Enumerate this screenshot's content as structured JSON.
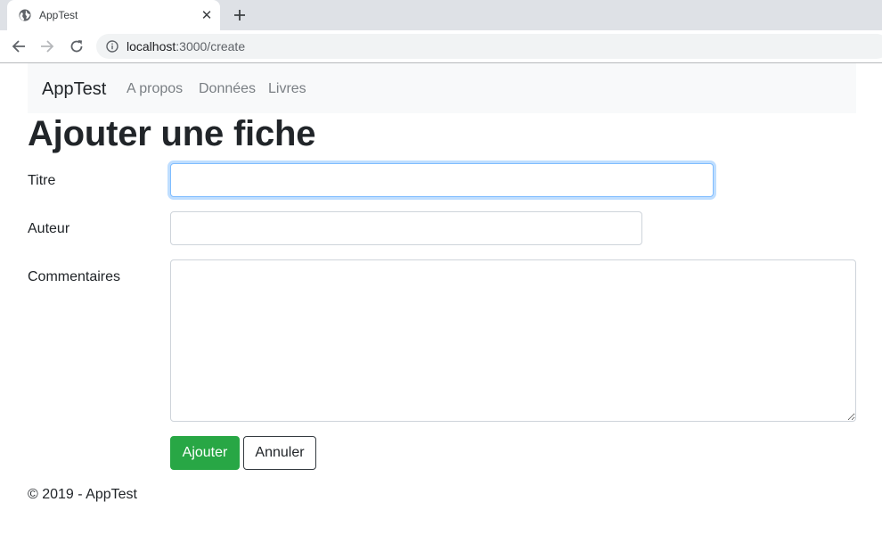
{
  "browser": {
    "tab_title": "AppTest",
    "close_glyph": "✕",
    "url_host": "localhost",
    "url_path": ":3000/create"
  },
  "navbar": {
    "brand": "AppTest",
    "links": [
      "A propos",
      "Données",
      "Livres"
    ]
  },
  "page": {
    "title": "Ajouter une fiche"
  },
  "form": {
    "fields": [
      {
        "label": "Titre",
        "value": "",
        "focused": true
      },
      {
        "label": "Auteur",
        "value": ""
      },
      {
        "label": "Commentaires",
        "value": ""
      }
    ],
    "buttons": {
      "submit": "Ajouter",
      "cancel": "Annuler"
    }
  },
  "footer": {
    "text": "© 2019 - AppTest"
  },
  "colors": {
    "success": "#28a745",
    "navbar_bg": "#f8f9fa",
    "focus_border": "#80bdff"
  },
  "icons": {
    "tab": "globe-icon",
    "close": "close-icon",
    "newtab": "plus-icon",
    "back": "back-arrow-icon",
    "forward": "forward-arrow-icon",
    "reload": "reload-icon",
    "site_info": "info-icon"
  }
}
